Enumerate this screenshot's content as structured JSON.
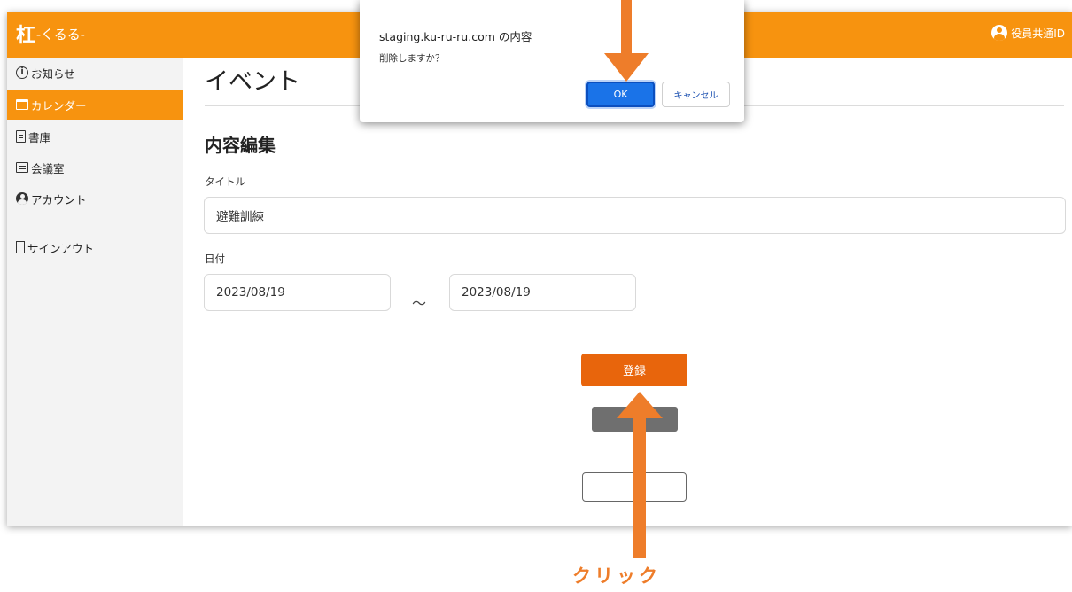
{
  "header": {
    "logo_mark": "杠",
    "logo_text": "-くるる-",
    "account_label": "役員共通ID"
  },
  "sidebar": {
    "items": [
      {
        "label": "お知らせ",
        "icon": "info-icon"
      },
      {
        "label": "カレンダー",
        "icon": "calendar-icon",
        "active": true
      },
      {
        "label": "書庫",
        "icon": "document-icon"
      },
      {
        "label": "会議室",
        "icon": "chat-icon"
      },
      {
        "label": "アカウント",
        "icon": "user-icon"
      }
    ],
    "signout_label": "サインアウト"
  },
  "main": {
    "page_title": "イベント",
    "section_title": "内容編集",
    "title_label": "タイトル",
    "title_value": "避難訓練",
    "date_label": "日付",
    "date_start": "2023/08/19",
    "date_separator": "〜",
    "date_end": "2023/08/19",
    "register_label": "登録"
  },
  "dialog": {
    "origin": "staging.ku-ru-ru.com の内容",
    "message": "削除しますか？",
    "ok_label": "OK",
    "cancel_label": "キャンセル"
  },
  "annotation": {
    "click_label": "クリック",
    "arrow_color": "#ee7d2a"
  },
  "colors": {
    "brand": "#f7930f",
    "register_button": "#e8650c",
    "dialog_ok": "#1a73e8"
  }
}
